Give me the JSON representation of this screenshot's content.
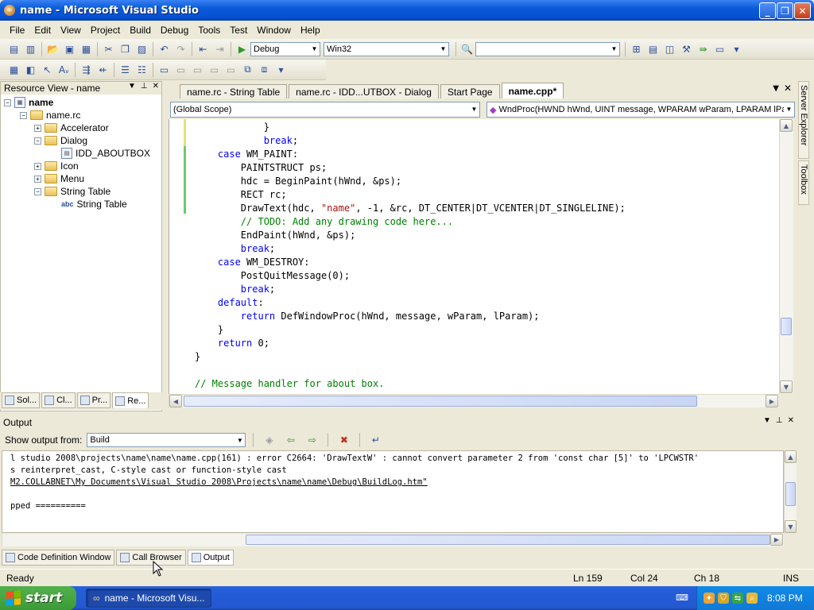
{
  "window": {
    "title": "name - Microsoft Visual Studio"
  },
  "menu": [
    "File",
    "Edit",
    "View",
    "Project",
    "Build",
    "Debug",
    "Tools",
    "Test",
    "Window",
    "Help"
  ],
  "toolbar": {
    "config": "Debug",
    "platform": "Win32",
    "find": ""
  },
  "resource_view": {
    "title": "Resource View - name",
    "tree": {
      "root": "name",
      "rc": "name.rc",
      "accelerator": "Accelerator",
      "dialog": "Dialog",
      "dialog_child": "IDD_ABOUTBOX",
      "icon": "Icon",
      "menu": "Menu",
      "string_table": "String Table",
      "string_table_child": "String Table"
    },
    "tabs": [
      "Sol...",
      "Cl...",
      "Pr...",
      "Re..."
    ]
  },
  "doc_tabs": [
    "name.rc - String Table",
    "name.rc - IDD...UTBOX - Dialog",
    "Start Page",
    "name.cpp*"
  ],
  "scope": {
    "left": "(Global Scope)",
    "right": "WndProc(HWND hWnd, UINT message, WPARAM wParam, LPARAM lPara"
  },
  "side_strip": [
    "Server Explorer",
    "Toolbox"
  ],
  "code_lines": [
    "            }",
    "            break;",
    "    case WM_PAINT:",
    "        PAINTSTRUCT ps;",
    "        hdc = BeginPaint(hWnd, &ps);",
    "        RECT rc;",
    "        DrawText(hdc, \"name\", -1, &rc, DT_CENTER|DT_VCENTER|DT_SINGLELINE);",
    "        // TODO: Add any drawing code here...",
    "        EndPaint(hWnd, &ps);",
    "        break;",
    "    case WM_DESTROY:",
    "        PostQuitMessage(0);",
    "        break;",
    "    default:",
    "        return DefWindowProc(hWnd, message, wParam, lParam);",
    "    }",
    "    return 0;",
    "}",
    "",
    "// Message handler for about box."
  ],
  "output": {
    "title": "Output",
    "show_from_label": "Show output from:",
    "show_from_value": "Build",
    "lines": [
      "l studio 2008\\projects\\name\\name\\name.cpp(161) : error C2664: 'DrawTextW' : cannot convert parameter 2 from 'const char [5]' to 'LPCWSTR'",
      "s reinterpret_cast, C-style cast or function-style cast",
      "M2.COLLABNET\\My Documents\\Visual Studio 2008\\Projects\\name\\name\\Debug\\BuildLog.htm\"",
      "",
      "pped =========="
    ],
    "tabs": [
      "Code Definition Window",
      "Call Browser",
      "Output"
    ]
  },
  "status": {
    "text": "Ready",
    "ln": "Ln 159",
    "col": "Col 24",
    "ch": "Ch 18",
    "mode": "INS"
  },
  "taskbar": {
    "start": "start",
    "item": "name - Microsoft Visu...",
    "clock": "8:08 PM"
  }
}
